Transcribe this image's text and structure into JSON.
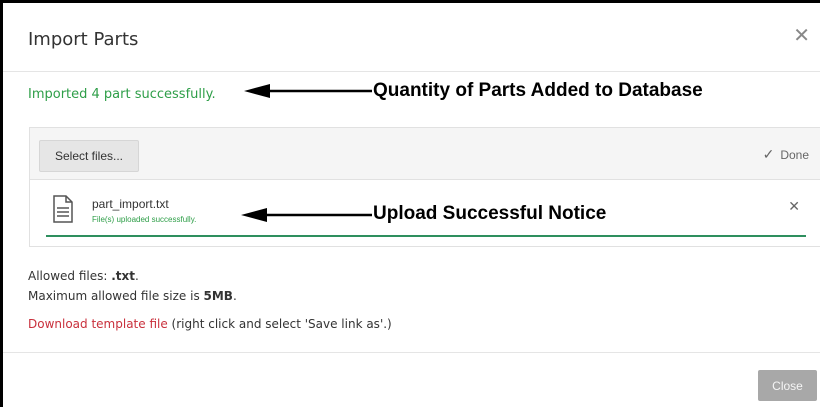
{
  "dialog": {
    "title": "Import Parts",
    "close_icon": "close-icon",
    "close_symbol": "✕"
  },
  "status": {
    "message": "Imported 4 part successfully."
  },
  "annotations": {
    "quantity": "Quantity of Parts Added to Database",
    "upload": "Upload Successful Notice"
  },
  "upload": {
    "select_label": "Select files...",
    "done_label": "Done",
    "done_symbol": "✓",
    "file": {
      "name": "part_import.txt",
      "status": "File(s) uploaded successfully.",
      "progress": 1.0,
      "remove_symbol": "✕"
    }
  },
  "info": {
    "allowed_prefix": "Allowed files: ",
    "allowed_value": ".txt",
    "allowed_suffix": ".",
    "max_prefix": "Maximum allowed file size is ",
    "max_value": "5MB",
    "max_suffix": ".",
    "download_link": "Download template file",
    "download_hint": " (right click and select 'Save link as'.)"
  },
  "footer": {
    "close_label": "Close"
  },
  "colors": {
    "success": "#2e9e48",
    "link": "#c9303c",
    "progress": "#2e8f5e"
  }
}
